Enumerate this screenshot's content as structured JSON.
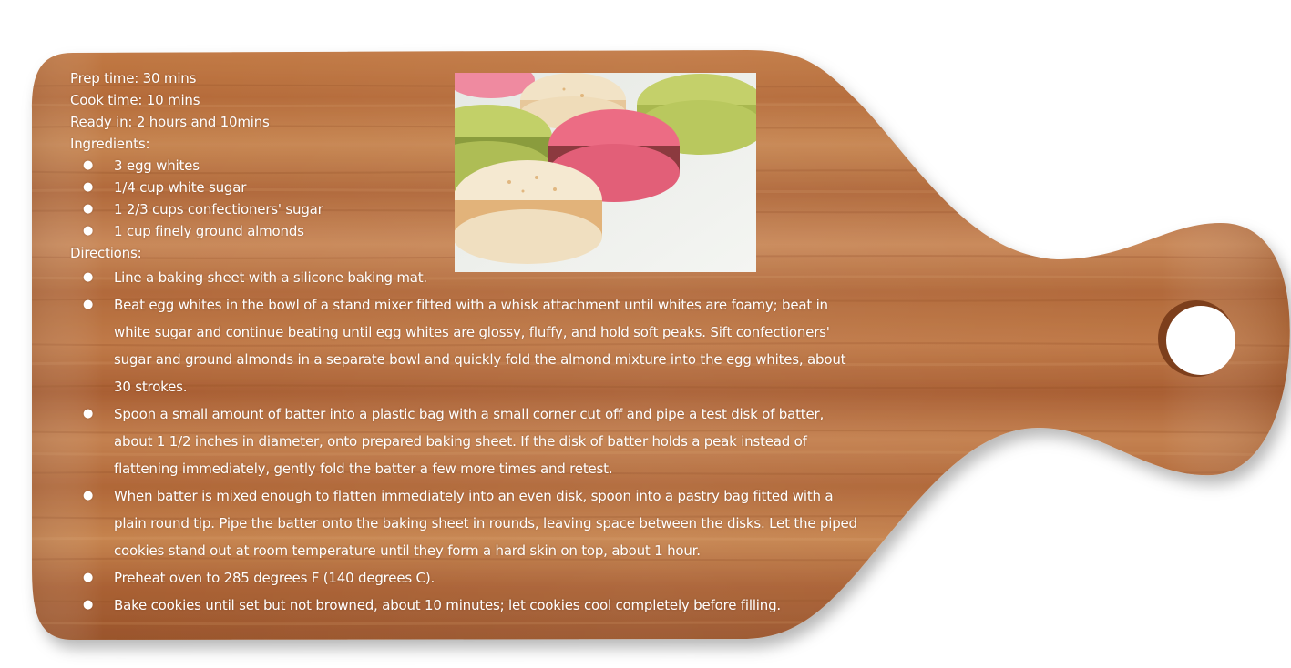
{
  "recipe": {
    "prep_time": "Prep time: 30 mins",
    "cook_time": "Cook time: 10 mins",
    "ready_in": "Ready in: 2 hours and 10mins",
    "ingredients_label": "Ingredients:",
    "ingredients": [
      "3 egg whites",
      "1/4 cup white sugar",
      "1 2/3 cups confectioners' sugar",
      "1 cup finely ground almonds"
    ],
    "directions_label": "Directions:",
    "directions": [
      "Line a baking sheet with a silicone baking mat.",
      "Beat egg whites in the bowl of a stand mixer fitted with a whisk attachment until whites are foamy; beat in white sugar and continue beating until egg whites are glossy, fluffy, and hold soft peaks. Sift confectioners' sugar and ground almonds in a separate bowl and quickly fold the almond mixture into the egg whites, about 30 strokes.",
      "Spoon a small amount of batter into a plastic bag with a small corner cut off and pipe a test disk of batter, about 1 1/2 inches in diameter, onto prepared baking sheet. If the disk of batter holds a peak instead of flattening immediately, gently fold the batter a few more times and retest.",
      "When batter is mixed enough to flatten immediately into an even disk, spoon into a pastry bag fitted with a plain round tip. Pipe the batter onto the baking sheet in rounds, leaving space between the disks. Let the piped cookies stand out at room temperature until they form a hard skin on top, about 1 hour.",
      "Preheat oven to 285 degrees F (140 degrees C).",
      "Bake cookies until set but not browned, about 10 minutes; let cookies cool completely before filling."
    ],
    "bullet": "●"
  },
  "photo": {
    "subject": "macarons",
    "colors": [
      "#a9bf4e",
      "#e9637a",
      "#f3e3c4",
      "#c7d26a"
    ]
  },
  "board": {
    "wood_light": "#c8834f",
    "wood_mid": "#b46a3a",
    "wood_dark": "#8f4c24"
  }
}
